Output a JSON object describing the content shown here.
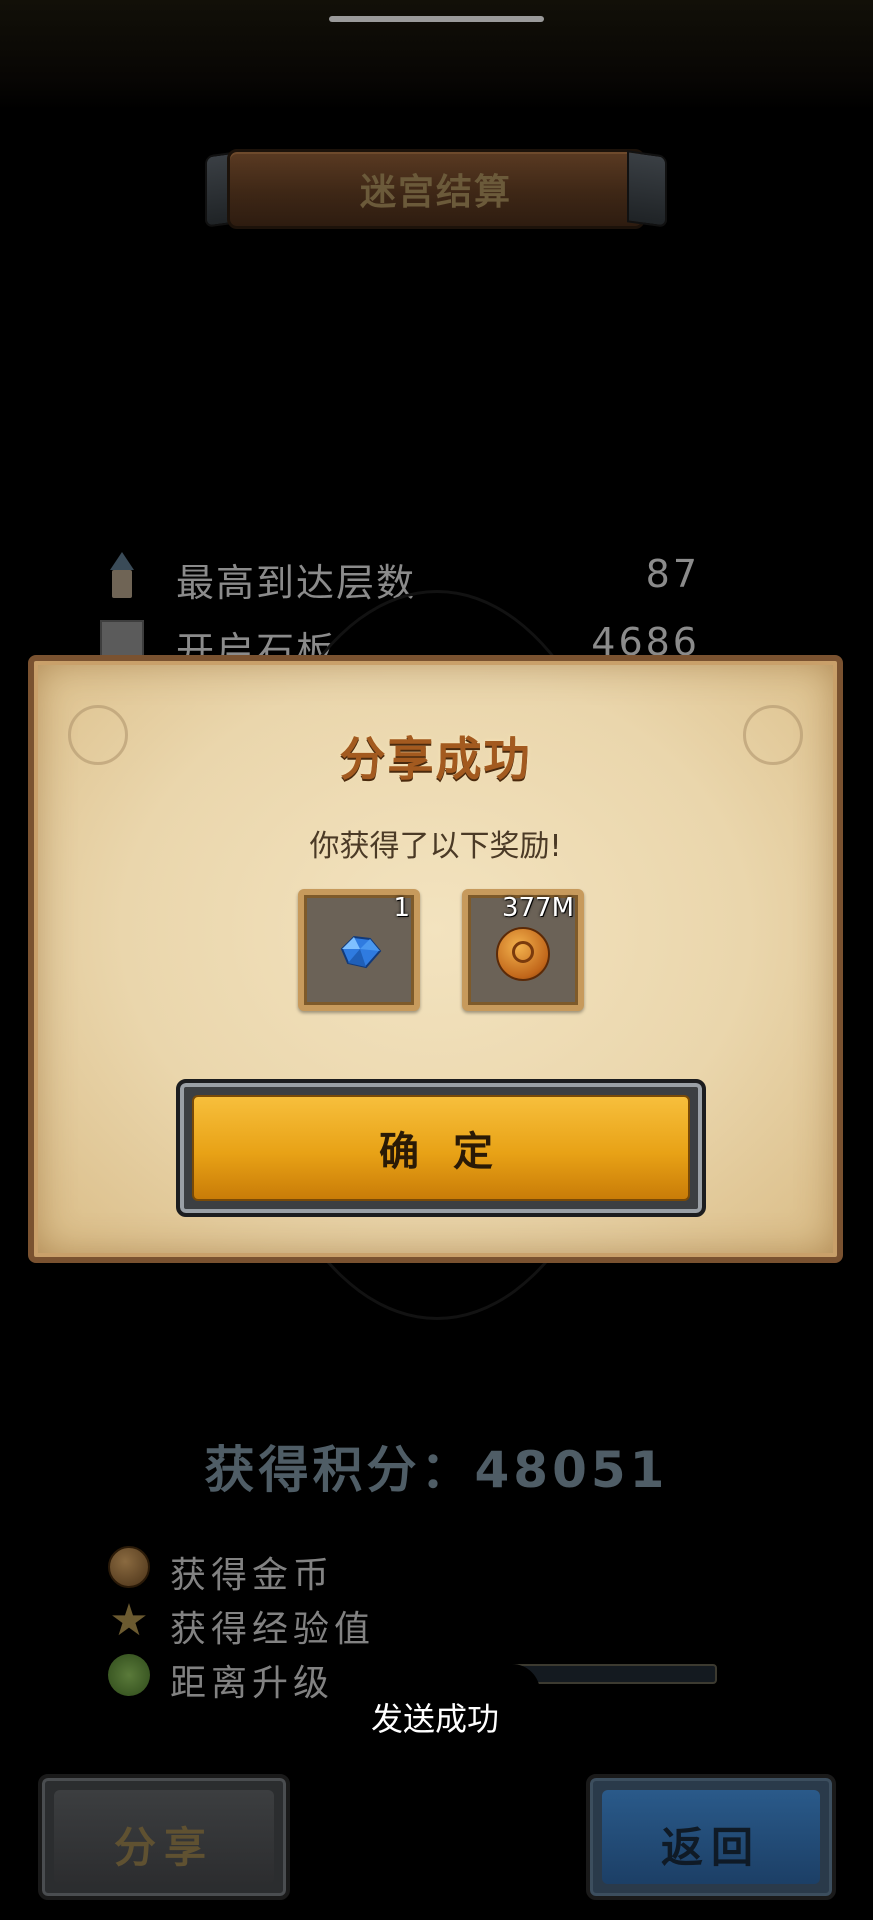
{
  "header": {
    "title": "迷宫结算"
  },
  "stats": [
    {
      "icon": "tower-icon",
      "label": "最高到达层数",
      "value": "87"
    },
    {
      "icon": "stone-slab-icon",
      "label": "开启石板",
      "value": "4686"
    }
  ],
  "dialog": {
    "title": "分享成功",
    "subtitle": "你获得了以下奖励!",
    "rewards": [
      {
        "icon": "blue-gem-icon",
        "quantity": "1"
      },
      {
        "icon": "gold-coin-icon",
        "quantity": "377M"
      }
    ],
    "confirm_label": "确 定"
  },
  "score": {
    "text": "获得积分：48051"
  },
  "reward_lines": [
    {
      "icon": "coin-icon",
      "label": "获得金币"
    },
    {
      "icon": "star-icon",
      "label": "获得经验值"
    },
    {
      "icon": "tree-icon",
      "label": "距离升级"
    }
  ],
  "toast": {
    "text": "发送成功"
  },
  "buttons": {
    "share_label": "分享",
    "back_label": "返回"
  },
  "colors": {
    "dialog_bg": "#ead6ac",
    "confirm_button": "#e8a216",
    "back_button": "#2a5a8a",
    "dialog_title": "#a35a1f"
  }
}
